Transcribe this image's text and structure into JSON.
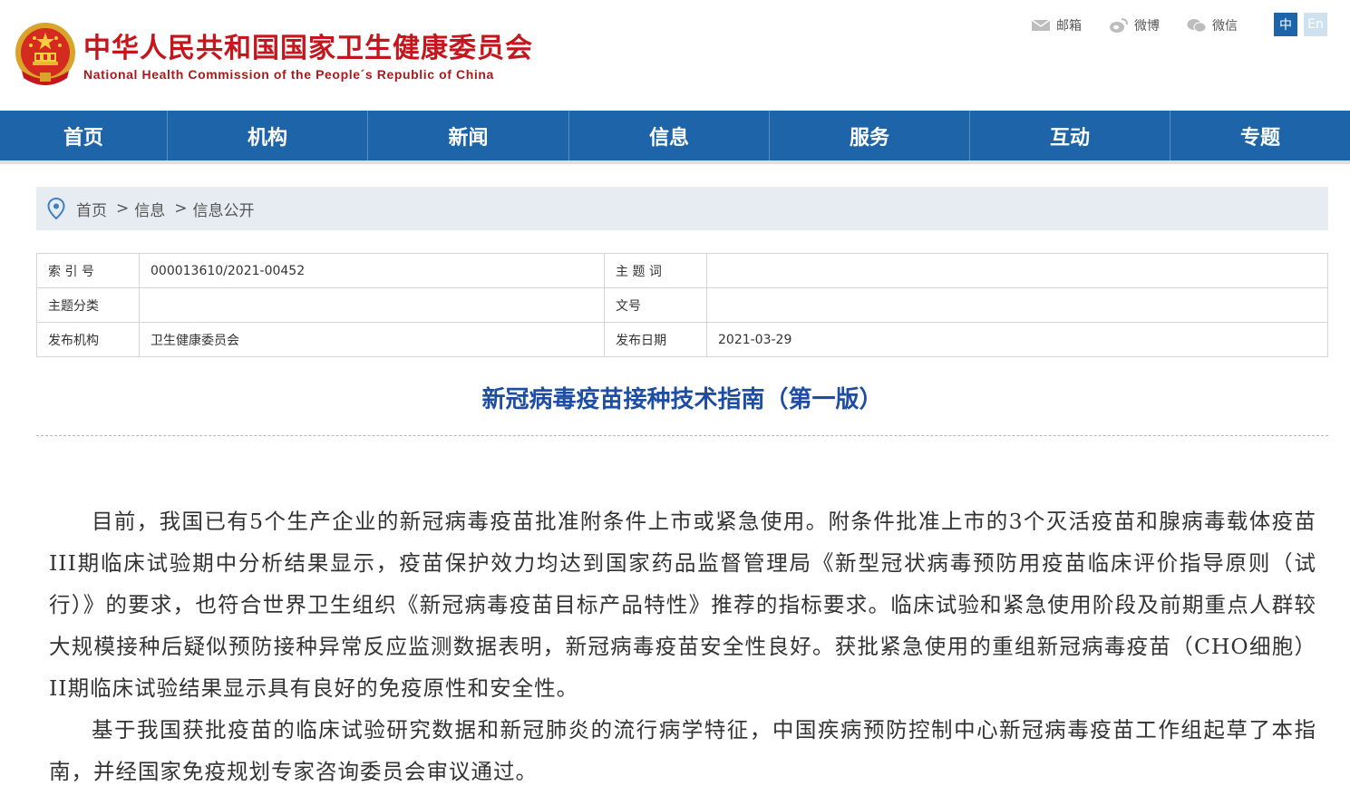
{
  "header": {
    "title_cn": "中华人民共和国国家卫生健康委员会",
    "title_en": "National Health Commission of the People´s Republic of China",
    "links": [
      {
        "icon": "mail-icon",
        "label": "邮箱"
      },
      {
        "icon": "weibo-icon",
        "label": "微博"
      },
      {
        "icon": "wechat-icon",
        "label": "微信"
      }
    ],
    "lang": {
      "zh": "中",
      "en": "En"
    }
  },
  "nav": {
    "items": [
      "首页",
      "机构",
      "新闻",
      "信息",
      "服务",
      "互动",
      "专题"
    ]
  },
  "breadcrumb": {
    "items": [
      "首页",
      "信息",
      "信息公开"
    ],
    "separator": ">"
  },
  "info": {
    "index_no_label": "索 引 号",
    "index_no": "000013610/2021-00452",
    "subject_words_label": "主 题 词",
    "subject_words": "",
    "category_label": "主题分类",
    "category": "",
    "doc_no_label": "文号",
    "doc_no": "",
    "publisher_label": "发布机构",
    "publisher": "卫生健康委员会",
    "date_label": "发布日期",
    "date": "2021-03-29"
  },
  "article": {
    "title": "新冠病毒疫苗接种技术指南（第一版）",
    "paragraphs": [
      "目前，我国已有5个生产企业的新冠病毒疫苗批准附条件上市或紧急使用。附条件批准上市的3个灭活疫苗和腺病毒载体疫苗III期临床试验期中分析结果显示，疫苗保护效力均达到国家药品监督管理局《新型冠状病毒预防用疫苗临床评价指导原则（试行）》的要求，也符合世界卫生组织《新冠病毒疫苗目标产品特性》推荐的指标要求。临床试验和紧急使用阶段及前期重点人群较大规模接种后疑似预防接种异常反应监测数据表明，新冠病毒疫苗安全性良好。获批紧急使用的重组新冠病毒疫苗（CHO细胞）II期临床试验结果显示具有良好的免疫原性和安全性。",
      "基于我国获批疫苗的临床试验研究数据和新冠肺炎的流行病学特征，中国疾病预防控制中心新冠病毒疫苗工作组起草了本指南，并经国家免疫规划专家咨询委员会审议通过。"
    ]
  },
  "colors": {
    "brand_blue": "#1d64a8",
    "title_red": "#c4161c",
    "article_title_blue": "#1d4ea3"
  }
}
